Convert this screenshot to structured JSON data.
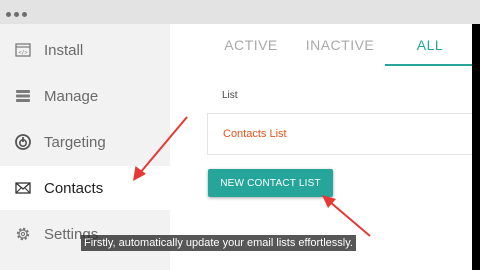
{
  "sidebar": {
    "items": [
      {
        "label": "Install",
        "icon": "code-window-icon"
      },
      {
        "label": "Manage",
        "icon": "list-icon"
      },
      {
        "label": "Targeting",
        "icon": "power-icon"
      },
      {
        "label": "Contacts",
        "icon": "envelope-icon"
      },
      {
        "label": "Settings",
        "icon": "gear-icon"
      }
    ],
    "active_index": 3
  },
  "tabs": [
    {
      "label": "ACTIVE"
    },
    {
      "label": "INACTIVE"
    },
    {
      "label": "ALL"
    }
  ],
  "active_tab": "ALL",
  "list_header": "List",
  "lists": [
    {
      "name": "Contacts List"
    }
  ],
  "new_contact_list_button": "NEW CONTACT LIST",
  "caption": "Firstly, automatically update your email lists effortlessly.",
  "colors": {
    "accent": "#26a69a",
    "link": "#e2541c",
    "annotation_arrow": "#e53935"
  }
}
